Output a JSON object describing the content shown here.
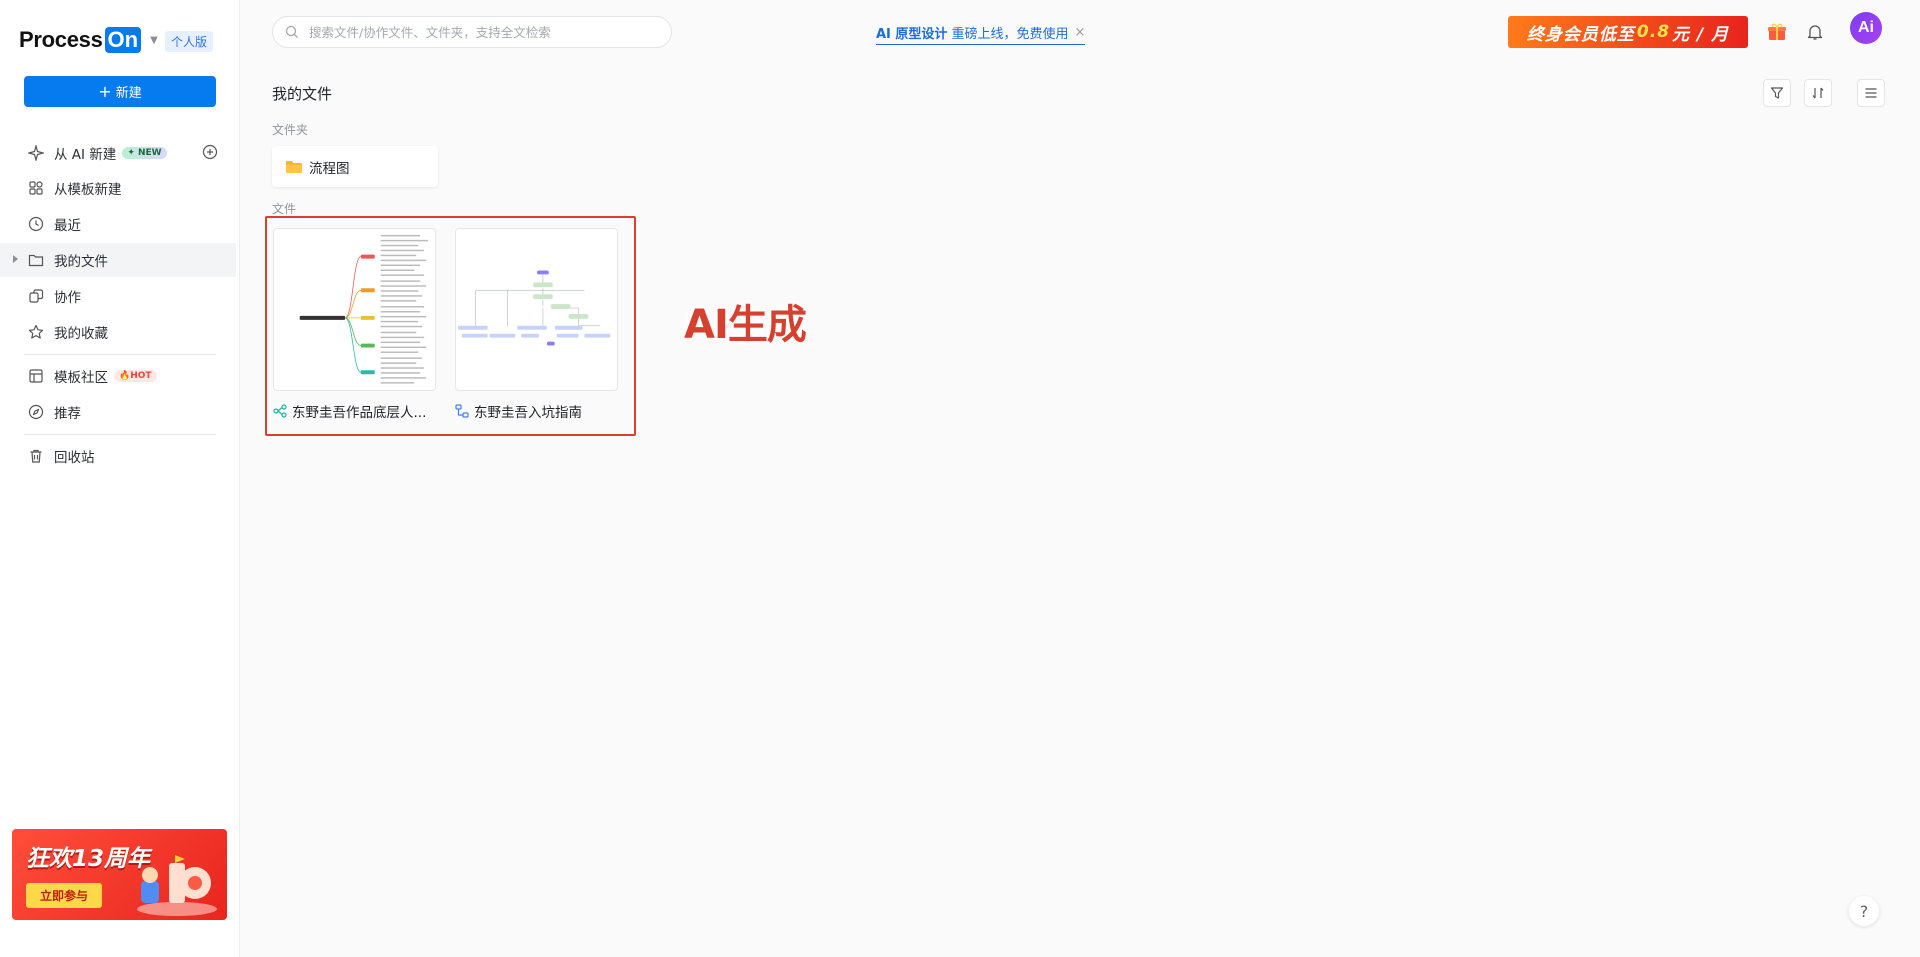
{
  "sidebar": {
    "logo_text": "Process",
    "logo_on": "On",
    "edition_badge": "个人版",
    "new_button": "新建",
    "new_plus": "+",
    "items": [
      {
        "label": "从 AI 新建",
        "tag": "NEW",
        "icon": "sparkle-icon"
      },
      {
        "label": "从模板新建",
        "icon": "template-grid-icon"
      },
      {
        "label": "最近",
        "icon": "clock-icon"
      },
      {
        "label": "我的文件",
        "icon": "folder-icon"
      },
      {
        "label": "协作",
        "icon": "collaborate-icon"
      },
      {
        "label": "我的收藏",
        "icon": "star-icon"
      },
      {
        "label": "模板社区",
        "tag": "HOT",
        "icon": "layout-icon"
      },
      {
        "label": "推荐",
        "icon": "compass-icon"
      },
      {
        "label": "回收站",
        "icon": "trash-icon"
      }
    ],
    "promo": {
      "title": "狂欢13周年",
      "button": "立即参与"
    }
  },
  "topbar": {
    "search_placeholder": "搜索文件/协作文件、文件夹，支持全文检索",
    "announce_bold": "AI 原型设计",
    "announce_text": "重磅上线，免费使用",
    "announce_close": "×",
    "vip_prefix": "终身会员低至",
    "vip_highlight": "0.8",
    "vip_suffix": "元 / 月",
    "avatar_text": "Ai"
  },
  "main": {
    "title": "我的文件",
    "folders_label": "文件夹",
    "folders": [
      {
        "name": "流程图"
      }
    ],
    "files_label": "文件",
    "files": [
      {
        "name": "东野圭吾作品底层人...",
        "type": "mindmap"
      },
      {
        "name": "东野圭吾入坑指南",
        "type": "flowchart"
      }
    ],
    "annotation": "AI生成",
    "help": "?"
  },
  "colors": {
    "primary": "#067bef",
    "annotation_red": "#d6402f",
    "avatar_purple": "#7b3ff2"
  }
}
